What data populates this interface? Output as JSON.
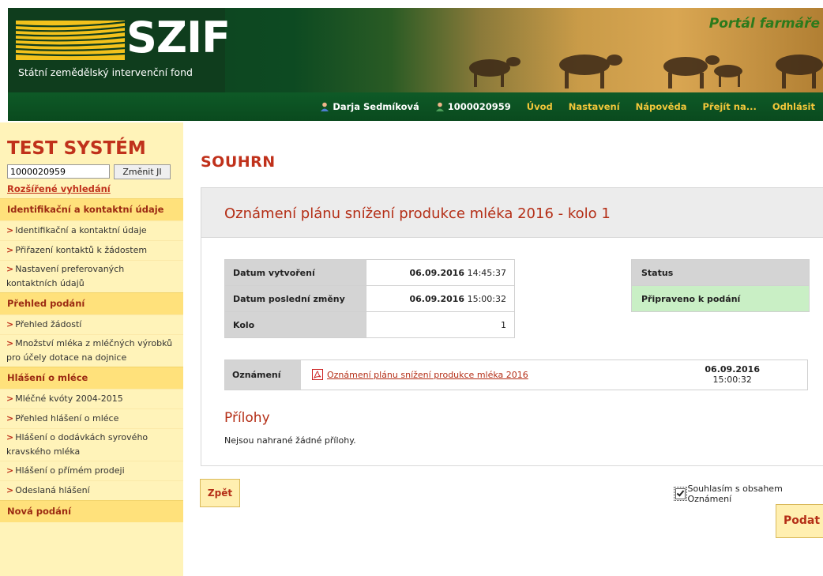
{
  "header": {
    "logo_text": "SZIF",
    "logo_subtitle": "Státní zemědělský intervenční fond",
    "portal_title": "Portál farmáře",
    "nav": [
      {
        "label": "Darja Sedmíková"
      },
      {
        "label": "1000020959"
      },
      {
        "label": "Úvod"
      },
      {
        "label": "Nastavení"
      },
      {
        "label": "Nápověda"
      },
      {
        "label": "Přejít na..."
      },
      {
        "label": "Odhlásit"
      }
    ]
  },
  "sidebar": {
    "system_title": "TEST SYSTÉM",
    "ji_value": "1000020959",
    "ji_button": "Změnit JI",
    "advanced_search": "Rozšířené vyhledání",
    "menu": [
      {
        "type": "section",
        "label": "Identifikační a kontaktní údaje"
      },
      {
        "type": "item",
        "label": "Identifikační a kontaktní údaje"
      },
      {
        "type": "item",
        "label": "Přiřazení kontaktů k žádostem"
      },
      {
        "type": "item",
        "label": "Nastavení preferovaných kontaktních údajů"
      },
      {
        "type": "section",
        "label": "Přehled podání"
      },
      {
        "type": "item",
        "label": "Přehled žádostí"
      },
      {
        "type": "item",
        "label": "Množství mléka z mléčných výrobků pro účely dotace na dojnice"
      },
      {
        "type": "section",
        "label": "Hlášení o mléce"
      },
      {
        "type": "item",
        "label": "Mléčné kvóty 2004-2015"
      },
      {
        "type": "item",
        "label": "Přehled hlášení o mléce"
      },
      {
        "type": "item",
        "label": "Hlášení o dodávkách syrového kravského mléka"
      },
      {
        "type": "item",
        "label": "Hlášení o přímém prodeji"
      },
      {
        "type": "item",
        "label": "Odeslaná hlášení"
      },
      {
        "type": "section",
        "label": "Nová podání"
      }
    ]
  },
  "main": {
    "page_title": "SOUHRN",
    "panel_title": "Oznámení plánu snížení produkce mléka 2016 - kolo 1",
    "info": [
      {
        "label": "Datum vytvoření",
        "date": "06.09.2016",
        "time": "14:45:37"
      },
      {
        "label": "Datum poslední změny",
        "date": "06.09.2016",
        "time": "15:00:32"
      },
      {
        "label": "Kolo",
        "value": "1"
      }
    ],
    "status_label": "Status",
    "status_value": "Připraveno k podání",
    "oznameni_label": "Oznámení",
    "oznameni_link": "Oznámení plánu snížení produkce mléka 2016",
    "oznameni_date": "06.09.2016",
    "oznameni_time": "15:00:32",
    "attachments_title": "Přílohy",
    "attachments_text": "Nejsou nahrané žádné přílohy."
  },
  "actions": {
    "back": "Zpět",
    "agree": "Souhlasím s obsahem Oznámení",
    "agree_checked": true,
    "submit": "Podat"
  }
}
